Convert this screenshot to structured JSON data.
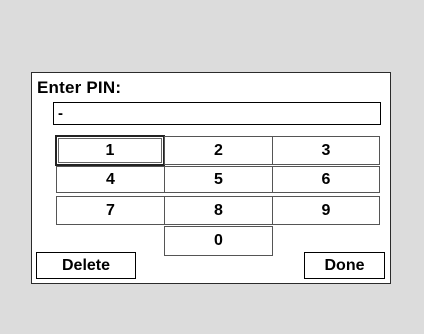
{
  "dialog": {
    "title": "Enter PIN:",
    "pin_value": "-"
  },
  "keypad": {
    "keys": [
      "1",
      "2",
      "3",
      "4",
      "5",
      "6",
      "7",
      "8",
      "9",
      "0"
    ]
  },
  "buttons": {
    "delete_label": "Delete",
    "done_label": "Done"
  }
}
